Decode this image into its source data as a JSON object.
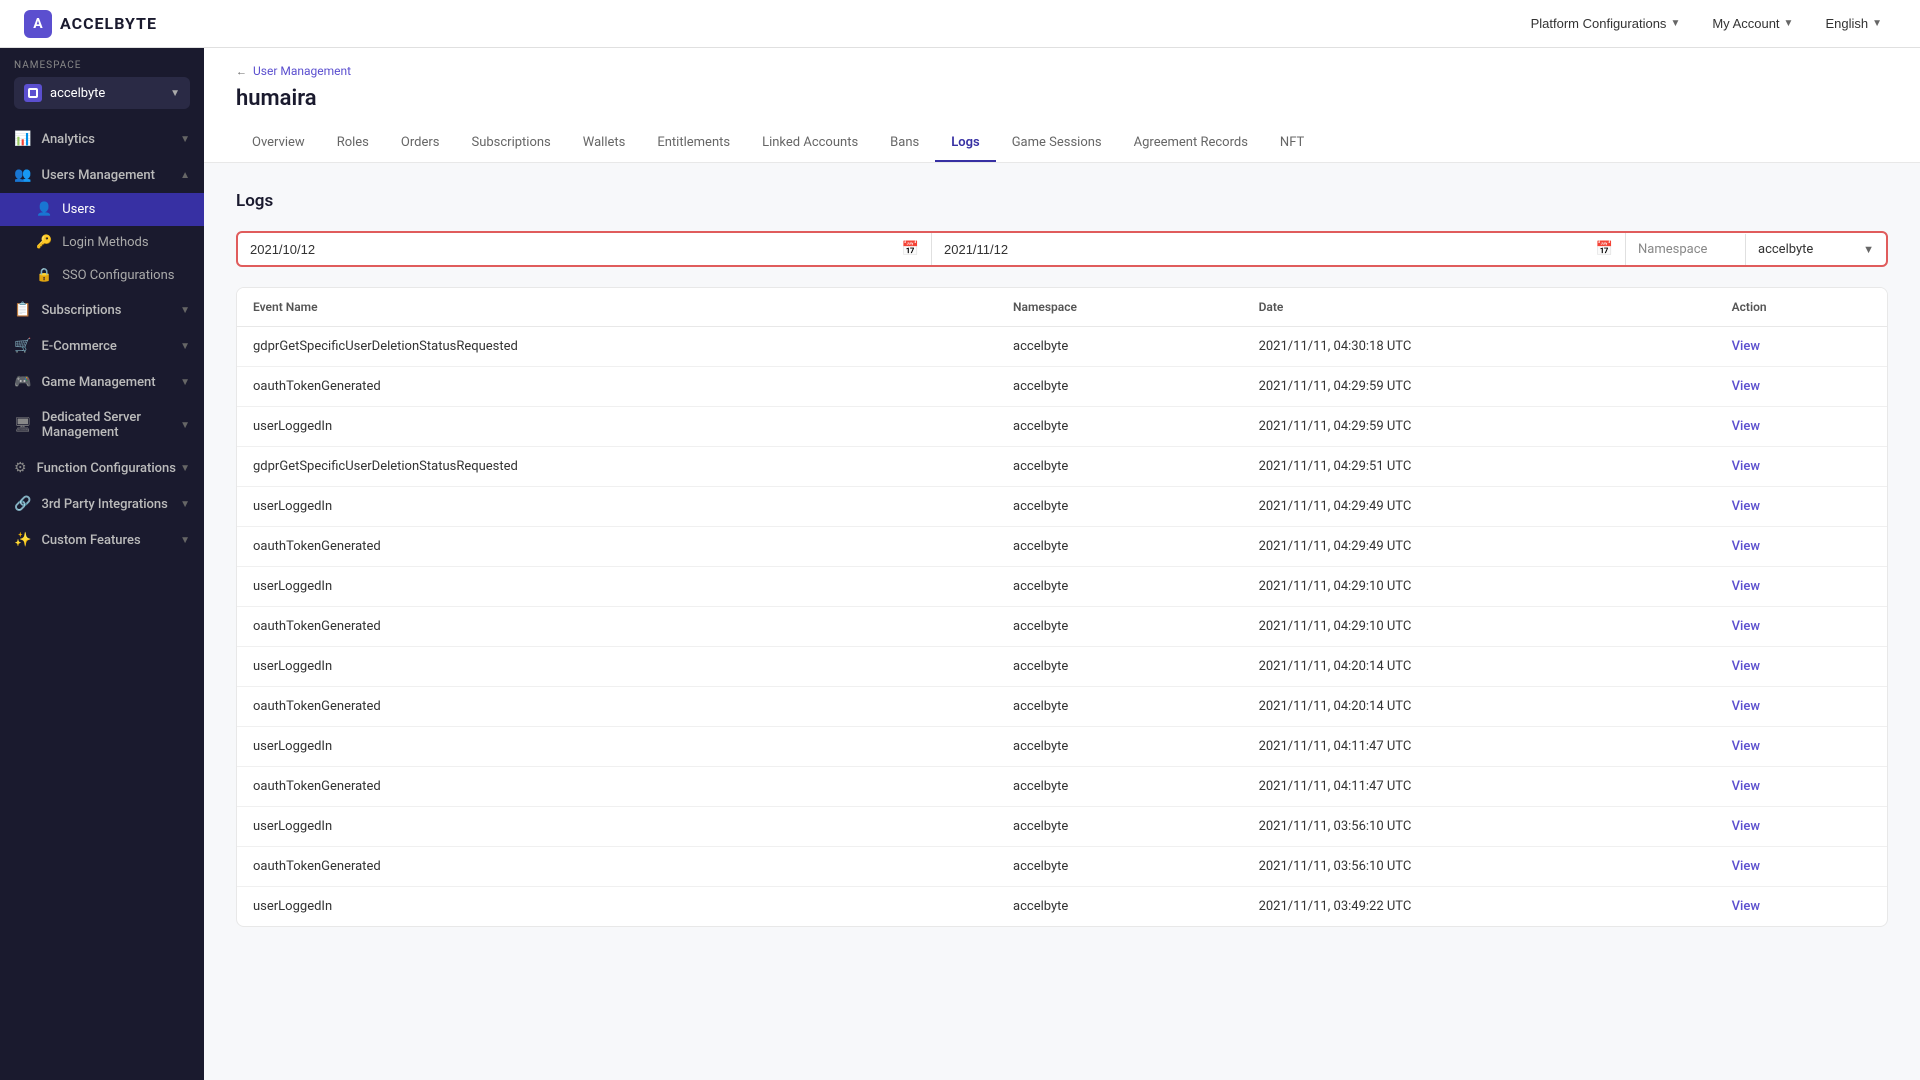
{
  "topbar": {
    "logo_letter": "A",
    "logo_name": "ACCELBYTE",
    "platform_config_label": "Platform Configurations",
    "my_account_label": "My Account",
    "english_label": "English"
  },
  "sidebar": {
    "namespace_label": "NAMESPACE",
    "namespace_value": "accelbyte",
    "items": [
      {
        "id": "analytics",
        "label": "Analytics",
        "icon": "📊",
        "expanded": false
      },
      {
        "id": "users-management",
        "label": "Users Management",
        "icon": "👥",
        "expanded": true
      },
      {
        "id": "users",
        "label": "Users",
        "icon": "👤",
        "active": true
      },
      {
        "id": "login-methods",
        "label": "Login Methods",
        "icon": "🔑"
      },
      {
        "id": "sso-configurations",
        "label": "SSO Configurations",
        "icon": "🔒"
      },
      {
        "id": "subscriptions",
        "label": "Subscriptions",
        "icon": "📋",
        "expanded": false
      },
      {
        "id": "e-commerce",
        "label": "E-Commerce",
        "icon": "🛒",
        "expanded": false
      },
      {
        "id": "game-management",
        "label": "Game Management",
        "icon": "🎮",
        "expanded": false
      },
      {
        "id": "dedicated-server-management",
        "label": "Dedicated Server Management",
        "icon": "🖥",
        "expanded": false
      },
      {
        "id": "function-configurations",
        "label": "Function Configurations",
        "icon": "⚙",
        "expanded": false
      },
      {
        "id": "3rd-party-integrations",
        "label": "3rd Party Integrations",
        "icon": "🔗",
        "expanded": false
      },
      {
        "id": "custom-features",
        "label": "Custom Features",
        "icon": "✨",
        "expanded": false
      }
    ]
  },
  "breadcrumb": {
    "back_label": "User Management"
  },
  "page": {
    "title": "humaira"
  },
  "tabs": [
    {
      "id": "overview",
      "label": "Overview"
    },
    {
      "id": "roles",
      "label": "Roles"
    },
    {
      "id": "orders",
      "label": "Orders"
    },
    {
      "id": "subscriptions",
      "label": "Subscriptions"
    },
    {
      "id": "wallets",
      "label": "Wallets"
    },
    {
      "id": "entitlements",
      "label": "Entitlements"
    },
    {
      "id": "linked-accounts",
      "label": "Linked Accounts"
    },
    {
      "id": "bans",
      "label": "Bans"
    },
    {
      "id": "logs",
      "label": "Logs",
      "active": true
    },
    {
      "id": "game-sessions",
      "label": "Game Sessions"
    },
    {
      "id": "agreement-records",
      "label": "Agreement Records"
    },
    {
      "id": "nft",
      "label": "NFT"
    }
  ],
  "logs": {
    "section_title": "Logs",
    "date_from": "2021/10/12",
    "date_to": "2021/11/12",
    "namespace_filter_label": "Namespace",
    "namespace_filter_value": "accelbyte",
    "columns": {
      "event_name": "Event Name",
      "namespace": "Namespace",
      "date": "Date",
      "action": "Action"
    },
    "rows": [
      {
        "event_name": "gdprGetSpecificUserDeletionStatusRequested",
        "namespace": "accelbyte",
        "date": "2021/11/11, 04:30:18 UTC",
        "action": "View"
      },
      {
        "event_name": "oauthTokenGenerated",
        "namespace": "accelbyte",
        "date": "2021/11/11, 04:29:59 UTC",
        "action": "View"
      },
      {
        "event_name": "userLoggedIn",
        "namespace": "accelbyte",
        "date": "2021/11/11, 04:29:59 UTC",
        "action": "View"
      },
      {
        "event_name": "gdprGetSpecificUserDeletionStatusRequested",
        "namespace": "accelbyte",
        "date": "2021/11/11, 04:29:51 UTC",
        "action": "View"
      },
      {
        "event_name": "userLoggedIn",
        "namespace": "accelbyte",
        "date": "2021/11/11, 04:29:49 UTC",
        "action": "View"
      },
      {
        "event_name": "oauthTokenGenerated",
        "namespace": "accelbyte",
        "date": "2021/11/11, 04:29:49 UTC",
        "action": "View"
      },
      {
        "event_name": "userLoggedIn",
        "namespace": "accelbyte",
        "date": "2021/11/11, 04:29:10 UTC",
        "action": "View"
      },
      {
        "event_name": "oauthTokenGenerated",
        "namespace": "accelbyte",
        "date": "2021/11/11, 04:29:10 UTC",
        "action": "View"
      },
      {
        "event_name": "userLoggedIn",
        "namespace": "accelbyte",
        "date": "2021/11/11, 04:20:14 UTC",
        "action": "View"
      },
      {
        "event_name": "oauthTokenGenerated",
        "namespace": "accelbyte",
        "date": "2021/11/11, 04:20:14 UTC",
        "action": "View"
      },
      {
        "event_name": "userLoggedIn",
        "namespace": "accelbyte",
        "date": "2021/11/11, 04:11:47 UTC",
        "action": "View"
      },
      {
        "event_name": "oauthTokenGenerated",
        "namespace": "accelbyte",
        "date": "2021/11/11, 04:11:47 UTC",
        "action": "View"
      },
      {
        "event_name": "userLoggedIn",
        "namespace": "accelbyte",
        "date": "2021/11/11, 03:56:10 UTC",
        "action": "View"
      },
      {
        "event_name": "oauthTokenGenerated",
        "namespace": "accelbyte",
        "date": "2021/11/11, 03:56:10 UTC",
        "action": "View"
      },
      {
        "event_name": "userLoggedIn",
        "namespace": "accelbyte",
        "date": "2021/11/11, 03:49:22 UTC",
        "action": "View"
      }
    ]
  }
}
